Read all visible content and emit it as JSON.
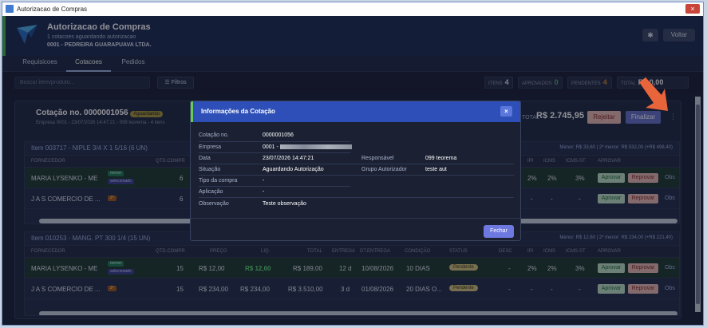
{
  "window": {
    "title": "Autorizacao de Compras",
    "close_label": "×"
  },
  "header": {
    "title": "Autorizacao de Compras",
    "subtitle": "1 cotacoes aguardando autorizacao",
    "company": "0001 - PEDREIRA GUARAPUAVA LTDA.",
    "gear_label": "✱",
    "back_label": "Voltar"
  },
  "tabs": [
    {
      "label": "Requisicoes"
    },
    {
      "label": "Cotacoes"
    },
    {
      "label": "Pedidos"
    }
  ],
  "toolbar": {
    "search_placeholder": "Buscar item/produto...",
    "filters_label": "☰ Filtros",
    "chips": [
      {
        "label": "ITENS",
        "value": "4",
        "color": "#d8dfef"
      },
      {
        "label": "APROVADOS",
        "value": "0",
        "color": "#48b36a"
      },
      {
        "label": "PENDENTES",
        "value": "4",
        "color": "#d0822f"
      },
      {
        "label": "TOTAL",
        "value": "R$ 0,00",
        "color": "#ffffff"
      }
    ]
  },
  "quotation": {
    "title": "Cotação no. 0000001056",
    "status": "Aguardando",
    "subtitle": "Empresa 0001 - 23/07/2026 14:47:21 - 099 teorema - 4 itens",
    "total_label": "TOTAL",
    "total_value": "R$ 2.745,95",
    "reject_label": "Rejeitar",
    "finalize_label": "Finalizar",
    "more_label": "⋮"
  },
  "columns": {
    "fornecedor": "FORNECEDOR",
    "qtd": "QTD.COMPR",
    "preco": "PREÇO",
    "liq": "LIQ.",
    "total": "TOTAL",
    "entrega": "ENTREGA",
    "dtentrega": "DT.ENTREGA",
    "condicao": "CONDIÇÃO",
    "status": "STATUS",
    "desc": "DESC",
    "ipi": "IPI",
    "icms": "ICMS",
    "icmsst": "ICMS-ST",
    "aprovar": "APROVAR"
  },
  "items": [
    {
      "title": "Item 003717 - NIPLE 3/4 X 1 5/16 (6 UN)",
      "menor": "Menor: R$ 33,60 | 2º menor: R$ 532,00 (+R$ 498,40)",
      "rows": [
        {
          "supplier": "MARIA LYSENKO - ME",
          "tag1": "menor",
          "tag2": "selecionado",
          "qtd": "6",
          "preco": "",
          "liq": "",
          "total": "",
          "entrega": "",
          "dtentrega": "",
          "condicao": "",
          "status": "",
          "desc": "",
          "ipi": "2%",
          "icms": "2%",
          "icmsst": "3%"
        },
        {
          "supplier": "J A S COMERCIO DE ...",
          "tag1": "2º",
          "tag2": "",
          "qtd": "6",
          "preco": "",
          "liq": "",
          "total": "",
          "entrega": "",
          "dtentrega": "",
          "condicao": "",
          "status": "",
          "desc": "",
          "ipi": "-",
          "icms": "-",
          "icmsst": "-"
        }
      ]
    },
    {
      "title": "Item 010253 - MANG. PT 300 1/4 (15 UN)",
      "menor": "Menor: R$ 12,60 | 2º menor: R$ 234,00 (+R$ 221,40)",
      "rows": [
        {
          "supplier": "MARIA LYSENKO - ME",
          "tag1": "menor",
          "tag2": "selecionado",
          "qtd": "15",
          "preco": "R$ 12,00",
          "liq": "R$ 12,60",
          "total": "R$ 189,00",
          "entrega": "12 d",
          "dtentrega": "10/08/2026",
          "condicao": "10 DIAS",
          "status": "Pendente",
          "desc": "-",
          "ipi": "2%",
          "icms": "2%",
          "icmsst": "3%"
        },
        {
          "supplier": "J A S COMERCIO DE ...",
          "tag1": "2º",
          "tag2": "",
          "qtd": "15",
          "preco": "R$ 234,00",
          "liq": "R$ 234,00",
          "total": "R$ 3.510,00",
          "entrega": "3 d",
          "dtentrega": "01/08/2026",
          "condicao": "20 DIAS O...",
          "status": "Pendente",
          "desc": "-",
          "ipi": "-",
          "icms": "-",
          "icmsst": "-"
        }
      ]
    }
  ],
  "row_actions": {
    "approve": "Aprovar",
    "reject": "Reprovar",
    "obs": "Obs"
  },
  "modal": {
    "title": "Informações da Cotação",
    "close_label": "×",
    "fields": {
      "cotacao_label": "Cotação no.",
      "cotacao_value": "0000001056",
      "empresa_label": "Empresa",
      "empresa_value": "0001 -",
      "data_label": "Data",
      "data_value": "23/07/2026 14:47:21",
      "responsavel_label": "Responsável",
      "responsavel_value": "099 teorema",
      "situacao_label": "Situação",
      "situacao_value": "Aguardando Autorização",
      "grupo_label": "Grupo Autorizador",
      "grupo_value": "teste aut",
      "tipo_label": "Tipo da compra",
      "tipo_value": "-",
      "aplicacao_label": "Aplicação",
      "aplicacao_value": "-",
      "observacao_label": "Observação",
      "observacao_value": "Teste observação"
    },
    "close_button": "Fechar"
  }
}
